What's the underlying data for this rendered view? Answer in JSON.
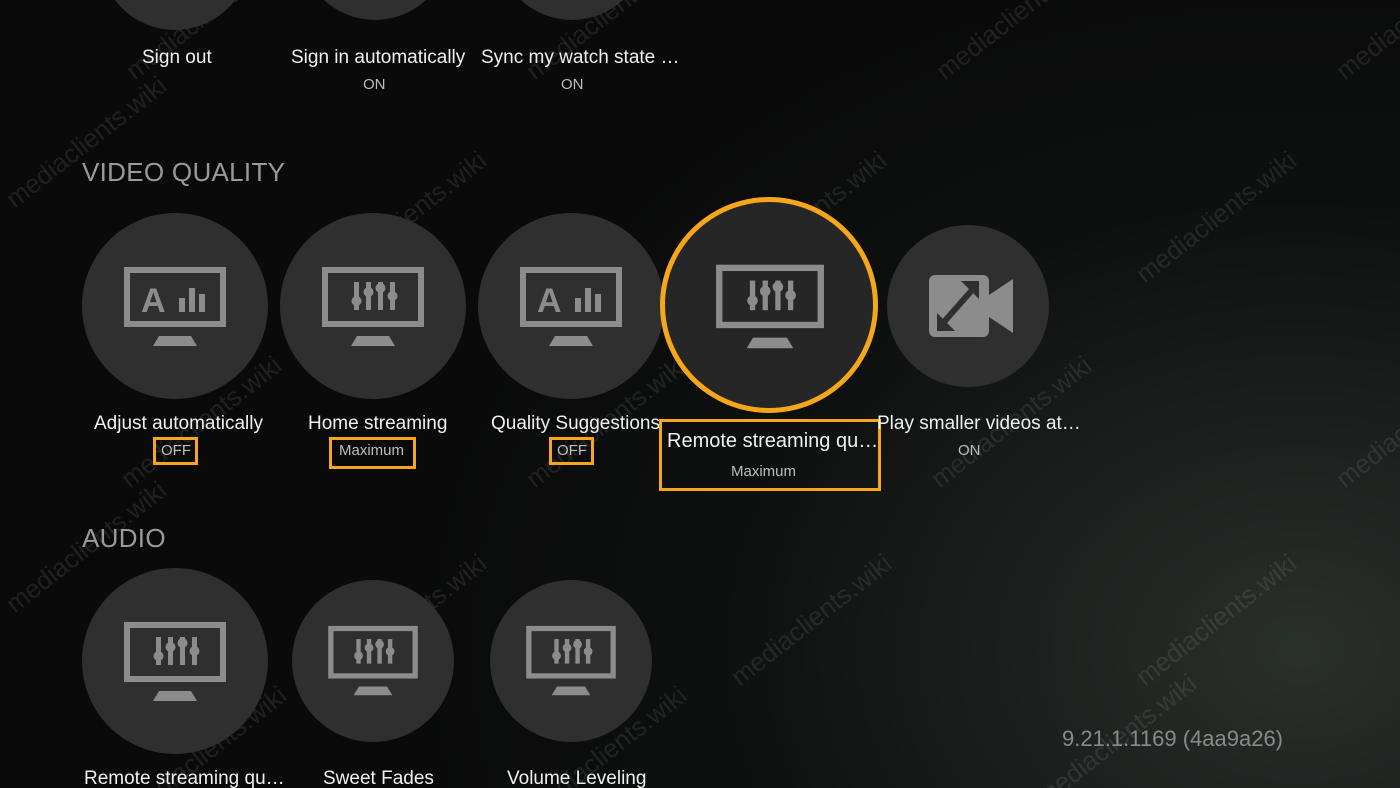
{
  "account": {
    "items": [
      {
        "label": "Sign out",
        "value": ""
      },
      {
        "label": "Sign in automatically",
        "value": "ON"
      },
      {
        "label": "Sync my watch state …",
        "value": "ON"
      }
    ]
  },
  "video_quality": {
    "header": "VIDEO QUALITY",
    "items": [
      {
        "label": "Adjust automatically",
        "value": "OFF",
        "icon": "monitor-a-bars-icon"
      },
      {
        "label": "Home streaming",
        "value": "Maximum",
        "icon": "monitor-sliders-icon"
      },
      {
        "label": "Quality Suggestions",
        "value": "OFF",
        "icon": "monitor-a-bars-icon"
      },
      {
        "label": "Remote streaming qu…",
        "value": "Maximum",
        "icon": "monitor-sliders-icon",
        "focused": true
      },
      {
        "label": "Play smaller videos at…",
        "value": "ON",
        "icon": "video-resize-icon"
      }
    ]
  },
  "audio": {
    "header": "AUDIO",
    "items": [
      {
        "label": "Remote streaming qu…",
        "icon": "monitor-sliders-icon"
      },
      {
        "label": "Sweet Fades",
        "icon": "monitor-sliders-icon"
      },
      {
        "label": "Volume Leveling",
        "icon": "monitor-sliders-icon"
      }
    ]
  },
  "version": "9.21.1.1169 (4aa9a26)",
  "watermark": "mediaclients.wiki",
  "colors": {
    "accent": "#f6a719",
    "circle": "#2f2f2f",
    "icon": "#8c8c8c"
  }
}
